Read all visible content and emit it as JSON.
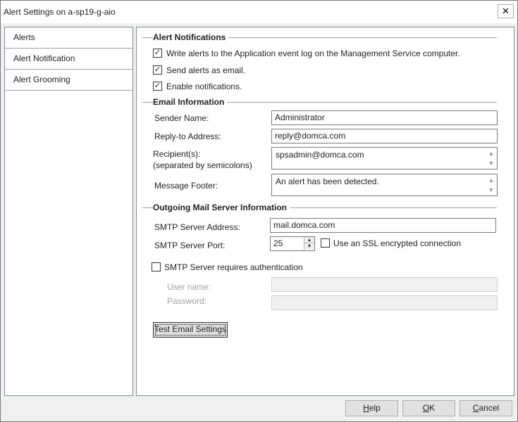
{
  "window": {
    "title": "Alert Settings on a-sp19-g-aio",
    "close_glyph": "✕"
  },
  "nav": {
    "items": [
      {
        "label": "Alerts"
      },
      {
        "label": "Alert Notification"
      },
      {
        "label": "Alert Grooming"
      }
    ]
  },
  "alert_notifications": {
    "heading": "Alert Notifications",
    "options": [
      {
        "label": "Write alerts to the Application event log on the Management Service computer.",
        "checked": true
      },
      {
        "label": "Send alerts as email.",
        "checked": true
      },
      {
        "label": "Enable notifications.",
        "checked": true
      }
    ]
  },
  "email_information": {
    "heading": "Email Information",
    "sender_name": {
      "label": "Sender Name:",
      "value": "Administrator"
    },
    "reply_to": {
      "label": "Reply-to Address:",
      "value": "reply@domca.com"
    },
    "recipients": {
      "label_line1": "Recipient(s):",
      "label_line2": "(separated by semicolons)",
      "value": "spsadmin@domca.com"
    },
    "message_footer": {
      "label": "Message Footer:",
      "value": "An alert has been detected."
    }
  },
  "outgoing_mail": {
    "heading": "Outgoing Mail Server Information",
    "smtp_address": {
      "label": "SMTP Server Address:",
      "value": "mail.domca.com"
    },
    "smtp_port": {
      "label": "SMTP Server Port:",
      "value": "25"
    },
    "ssl": {
      "label": "Use an SSL encrypted connection",
      "checked": false
    },
    "auth": {
      "label": "SMTP Server requires authentication",
      "checked": false
    },
    "username": {
      "label": "User name:",
      "value": ""
    },
    "password": {
      "label": "Password:",
      "value": ""
    },
    "test_button": "Test Email Settings"
  },
  "footer": {
    "help": {
      "prefix": "",
      "mnemonic": "H",
      "rest": "elp"
    },
    "ok": {
      "prefix": "",
      "mnemonic": "O",
      "rest": "K"
    },
    "cancel": {
      "prefix": "",
      "mnemonic": "C",
      "rest": "ancel"
    }
  },
  "glyphs": {
    "check": "✓",
    "up": "▲",
    "down": "▼"
  }
}
